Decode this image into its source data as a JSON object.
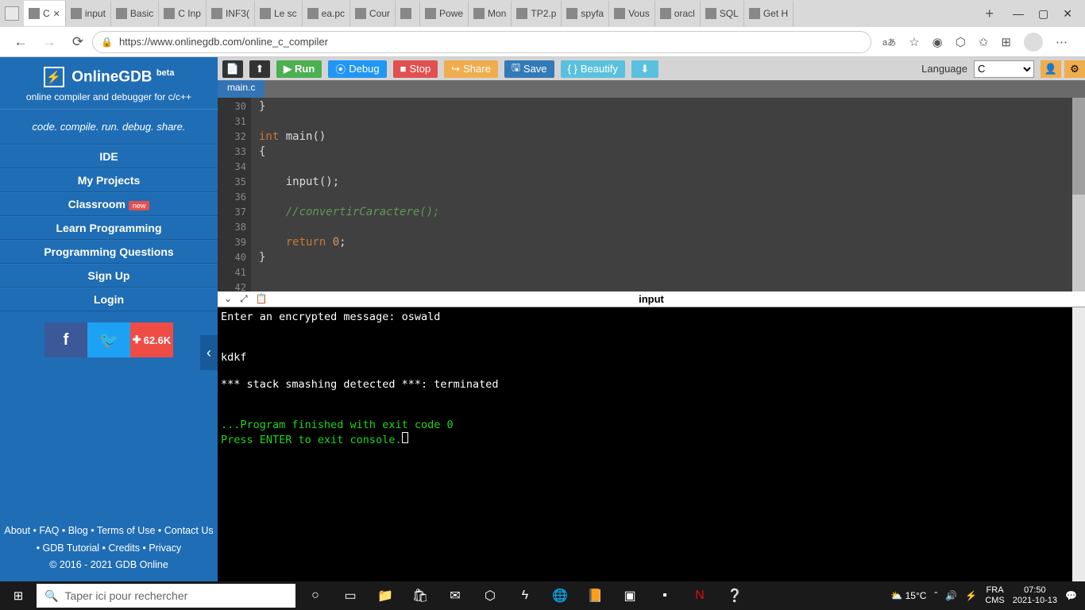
{
  "browser": {
    "tabs": [
      {
        "label": "C",
        "active": true
      },
      {
        "label": "input"
      },
      {
        "label": "Basic"
      },
      {
        "label": "C Inp"
      },
      {
        "label": "INF3("
      },
      {
        "label": "Le sc"
      },
      {
        "label": "ea.pc"
      },
      {
        "label": "Cour"
      },
      {
        "label": "‎"
      },
      {
        "label": "Powe"
      },
      {
        "label": "Mon"
      },
      {
        "label": "TP2.p"
      },
      {
        "label": "spyfa"
      },
      {
        "label": "Vous"
      },
      {
        "label": "oracl"
      },
      {
        "label": "SQL"
      },
      {
        "label": "Get H"
      }
    ],
    "url": "https://www.onlinegdb.com/online_c_compiler"
  },
  "sidebar": {
    "title": "OnlineGDB",
    "beta": "beta",
    "tagline": "online compiler and debugger for c/c++",
    "motto": "code. compile. run. debug. share.",
    "items": [
      {
        "label": "IDE"
      },
      {
        "label": "My Projects"
      },
      {
        "label": "Classroom",
        "badge": "new"
      },
      {
        "label": "Learn Programming"
      },
      {
        "label": "Programming Questions"
      },
      {
        "label": "Sign Up"
      },
      {
        "label": "Login"
      }
    ],
    "share_count": "62.6K",
    "footer": {
      "links1": "About • FAQ • Blog • Terms of Use • Contact Us",
      "links2": "• GDB Tutorial • Credits • Privacy",
      "copyright": "© 2016 - 2021 GDB Online"
    }
  },
  "toolbar": {
    "run": "Run",
    "debug": "Debug",
    "stop": "Stop",
    "share": "Share",
    "save": "Save",
    "beautify": "Beautify",
    "lang_label": "Language",
    "lang_value": "C"
  },
  "editor": {
    "tab": "main.c",
    "lines": [
      {
        "n": "30",
        "html": "<span class='punct'>}</span>"
      },
      {
        "n": "31",
        "html": ""
      },
      {
        "n": "32",
        "html": "<span class='kw'>int</span> <span class='fn'>main</span>()"
      },
      {
        "n": "33",
        "html": "<span class='punct'>{</span>"
      },
      {
        "n": "34",
        "html": ""
      },
      {
        "n": "35",
        "html": "    <span class='fn'>input</span>();"
      },
      {
        "n": "36",
        "html": ""
      },
      {
        "n": "37",
        "html": "    <span class='cm'>//convertirCaractere();</span>"
      },
      {
        "n": "38",
        "html": ""
      },
      {
        "n": "39",
        "html": "    <span class='kw'>return</span> <span class='num'>0</span>;"
      },
      {
        "n": "40",
        "html": "<span class='punct'>}</span>"
      },
      {
        "n": "41",
        "html": ""
      },
      {
        "n": "42",
        "html": ""
      }
    ]
  },
  "terminal": {
    "tab": "input",
    "line1": "Enter an encrypted message: oswald",
    "line2": "kdkf",
    "line3": "*** stack smashing detected ***: terminated",
    "line4": "...Program finished with exit code 0",
    "line5": "Press ENTER to exit console."
  },
  "taskbar": {
    "search_placeholder": "Taper ici pour rechercher",
    "weather": "15°C",
    "lang": "FRA",
    "ims": "CMS",
    "time": "07:50",
    "date": "2021-10-13"
  }
}
